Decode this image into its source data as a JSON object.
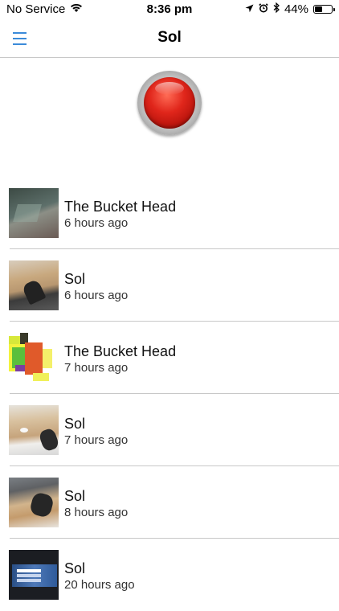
{
  "status_bar": {
    "carrier": "No Service",
    "time": "8:36 pm",
    "battery": "44%",
    "battery_level": 0.44
  },
  "nav": {
    "title": "Sol"
  },
  "feed": [
    {
      "title": "The Bucket Head",
      "time": "6 hours ago",
      "thumbnail": "room"
    },
    {
      "title": "Sol",
      "time": "6 hours ago",
      "thumbnail": "table"
    },
    {
      "title": "The Bucket Head",
      "time": "7 hours ago",
      "thumbnail": "pixel-art"
    },
    {
      "title": "Sol",
      "time": "7 hours ago",
      "thumbnail": "table"
    },
    {
      "title": "Sol",
      "time": "8 hours ago",
      "thumbnail": "office"
    },
    {
      "title": "Sol",
      "time": "20 hours ago",
      "thumbnail": "screen"
    }
  ],
  "colors": {
    "accent": "#3b8bd9",
    "record": "#e0261b",
    "divider": "#c8c8c8"
  }
}
